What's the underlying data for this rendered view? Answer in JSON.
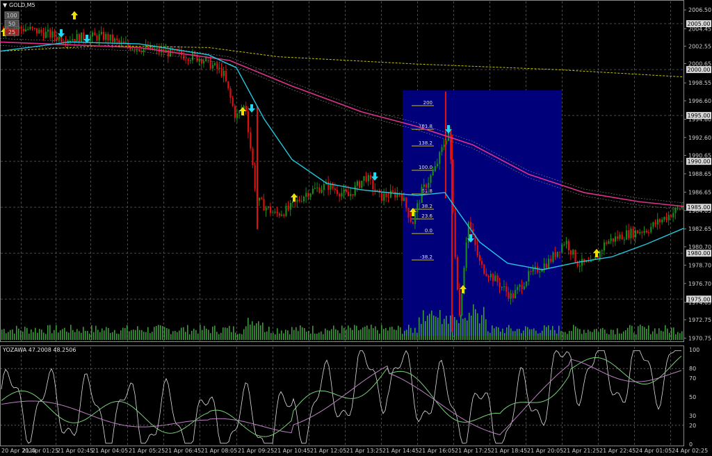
{
  "window": {
    "symbol_title": "GOLD,M5",
    "menu_glyph": "▼"
  },
  "corner_levels": [
    "100",
    "50",
    "25"
  ],
  "price_axis": {
    "ticks": [
      "2006.50",
      "2004.45",
      "2002.55",
      "2000.65",
      "1998.55",
      "1996.60",
      "1994.60",
      "1992.60",
      "1990.65",
      "1988.65",
      "1986.65",
      "1984.65",
      "1982.65",
      "1980.70",
      "1978.70",
      "1976.70",
      "1974.65",
      "1972.75",
      "1970.75"
    ],
    "boxes": [
      {
        "label": "2005.00",
        "value": 2005.0
      },
      {
        "label": "2000.00",
        "value": 2000.0
      },
      {
        "label": "1995.00",
        "value": 1995.0
      },
      {
        "label": "1990.00",
        "value": 1990.0
      },
      {
        "label": "1985.00",
        "value": 1985.0
      },
      {
        "label": "1980.00",
        "value": 1980.0
      },
      {
        "label": "1975.00",
        "value": 1975.0
      }
    ]
  },
  "time_axis": [
    "20 Apr 2023",
    "21 Apr 01:25",
    "21 Apr 02:45",
    "21 Apr 04:05",
    "21 Apr 05:25",
    "21 Apr 06:45",
    "21 Apr 08:05",
    "21 Apr 09:25",
    "21 Apr 10:45",
    "21 Apr 12:05",
    "21 Apr 13:25",
    "21 Apr 14:45",
    "21 Apr 16:05",
    "21 Apr 17:25",
    "21 Apr 18:45",
    "21 Apr 20:05",
    "21 Apr 21:25",
    "21 Apr 22:45",
    "24 Apr 01:05",
    "24 Apr 02:25"
  ],
  "fibonacci": {
    "levels": [
      "200",
      "161.8",
      "138.2",
      "100.0",
      "61.8",
      "38.2",
      "23.6",
      "0.0",
      "-38.2"
    ]
  },
  "oscillator": {
    "title": "YOZAWA 47.2008 48.2506",
    "ticks": [
      "100",
      "80",
      "70",
      "50",
      "30",
      "20",
      "0"
    ]
  },
  "colors": {
    "bull": "#1a8a1a",
    "bear": "#e01010",
    "ma_fast": "#22c8e0",
    "ma_slow": "#e0308c",
    "ma_long": "#c8c800",
    "fib_zone": "#00007a",
    "volume": "#3c9a3c",
    "grid": "#4a4a4a",
    "arrow_up": "#f0e000",
    "arrow_down": "#22d8f0",
    "osc_white": "#e0e0e0",
    "osc_green": "#7ad07a",
    "osc_violet": "#c080c8"
  }
}
